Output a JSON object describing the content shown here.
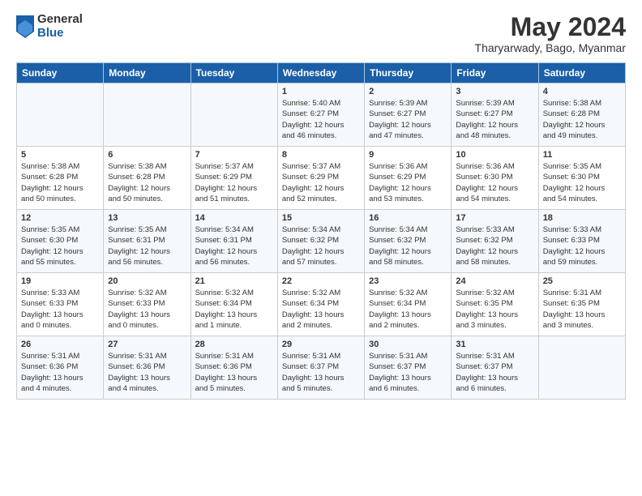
{
  "logo": {
    "general": "General",
    "blue": "Blue"
  },
  "title": "May 2024",
  "location": "Tharyarwady, Bago, Myanmar",
  "days_of_week": [
    "Sunday",
    "Monday",
    "Tuesday",
    "Wednesday",
    "Thursday",
    "Friday",
    "Saturday"
  ],
  "weeks": [
    [
      {
        "day": "",
        "detail": ""
      },
      {
        "day": "",
        "detail": ""
      },
      {
        "day": "",
        "detail": ""
      },
      {
        "day": "1",
        "detail": "Sunrise: 5:40 AM\nSunset: 6:27 PM\nDaylight: 12 hours\nand 46 minutes."
      },
      {
        "day": "2",
        "detail": "Sunrise: 5:39 AM\nSunset: 6:27 PM\nDaylight: 12 hours\nand 47 minutes."
      },
      {
        "day": "3",
        "detail": "Sunrise: 5:39 AM\nSunset: 6:27 PM\nDaylight: 12 hours\nand 48 minutes."
      },
      {
        "day": "4",
        "detail": "Sunrise: 5:38 AM\nSunset: 6:28 PM\nDaylight: 12 hours\nand 49 minutes."
      }
    ],
    [
      {
        "day": "5",
        "detail": "Sunrise: 5:38 AM\nSunset: 6:28 PM\nDaylight: 12 hours\nand 50 minutes."
      },
      {
        "day": "6",
        "detail": "Sunrise: 5:38 AM\nSunset: 6:28 PM\nDaylight: 12 hours\nand 50 minutes."
      },
      {
        "day": "7",
        "detail": "Sunrise: 5:37 AM\nSunset: 6:29 PM\nDaylight: 12 hours\nand 51 minutes."
      },
      {
        "day": "8",
        "detail": "Sunrise: 5:37 AM\nSunset: 6:29 PM\nDaylight: 12 hours\nand 52 minutes."
      },
      {
        "day": "9",
        "detail": "Sunrise: 5:36 AM\nSunset: 6:29 PM\nDaylight: 12 hours\nand 53 minutes."
      },
      {
        "day": "10",
        "detail": "Sunrise: 5:36 AM\nSunset: 6:30 PM\nDaylight: 12 hours\nand 54 minutes."
      },
      {
        "day": "11",
        "detail": "Sunrise: 5:35 AM\nSunset: 6:30 PM\nDaylight: 12 hours\nand 54 minutes."
      }
    ],
    [
      {
        "day": "12",
        "detail": "Sunrise: 5:35 AM\nSunset: 6:30 PM\nDaylight: 12 hours\nand 55 minutes."
      },
      {
        "day": "13",
        "detail": "Sunrise: 5:35 AM\nSunset: 6:31 PM\nDaylight: 12 hours\nand 56 minutes."
      },
      {
        "day": "14",
        "detail": "Sunrise: 5:34 AM\nSunset: 6:31 PM\nDaylight: 12 hours\nand 56 minutes."
      },
      {
        "day": "15",
        "detail": "Sunrise: 5:34 AM\nSunset: 6:32 PM\nDaylight: 12 hours\nand 57 minutes."
      },
      {
        "day": "16",
        "detail": "Sunrise: 5:34 AM\nSunset: 6:32 PM\nDaylight: 12 hours\nand 58 minutes."
      },
      {
        "day": "17",
        "detail": "Sunrise: 5:33 AM\nSunset: 6:32 PM\nDaylight: 12 hours\nand 58 minutes."
      },
      {
        "day": "18",
        "detail": "Sunrise: 5:33 AM\nSunset: 6:33 PM\nDaylight: 12 hours\nand 59 minutes."
      }
    ],
    [
      {
        "day": "19",
        "detail": "Sunrise: 5:33 AM\nSunset: 6:33 PM\nDaylight: 13 hours\nand 0 minutes."
      },
      {
        "day": "20",
        "detail": "Sunrise: 5:32 AM\nSunset: 6:33 PM\nDaylight: 13 hours\nand 0 minutes."
      },
      {
        "day": "21",
        "detail": "Sunrise: 5:32 AM\nSunset: 6:34 PM\nDaylight: 13 hours\nand 1 minute."
      },
      {
        "day": "22",
        "detail": "Sunrise: 5:32 AM\nSunset: 6:34 PM\nDaylight: 13 hours\nand 2 minutes."
      },
      {
        "day": "23",
        "detail": "Sunrise: 5:32 AM\nSunset: 6:34 PM\nDaylight: 13 hours\nand 2 minutes."
      },
      {
        "day": "24",
        "detail": "Sunrise: 5:32 AM\nSunset: 6:35 PM\nDaylight: 13 hours\nand 3 minutes."
      },
      {
        "day": "25",
        "detail": "Sunrise: 5:31 AM\nSunset: 6:35 PM\nDaylight: 13 hours\nand 3 minutes."
      }
    ],
    [
      {
        "day": "26",
        "detail": "Sunrise: 5:31 AM\nSunset: 6:36 PM\nDaylight: 13 hours\nand 4 minutes."
      },
      {
        "day": "27",
        "detail": "Sunrise: 5:31 AM\nSunset: 6:36 PM\nDaylight: 13 hours\nand 4 minutes."
      },
      {
        "day": "28",
        "detail": "Sunrise: 5:31 AM\nSunset: 6:36 PM\nDaylight: 13 hours\nand 5 minutes."
      },
      {
        "day": "29",
        "detail": "Sunrise: 5:31 AM\nSunset: 6:37 PM\nDaylight: 13 hours\nand 5 minutes."
      },
      {
        "day": "30",
        "detail": "Sunrise: 5:31 AM\nSunset: 6:37 PM\nDaylight: 13 hours\nand 6 minutes."
      },
      {
        "day": "31",
        "detail": "Sunrise: 5:31 AM\nSunset: 6:37 PM\nDaylight: 13 hours\nand 6 minutes."
      },
      {
        "day": "",
        "detail": ""
      }
    ]
  ]
}
